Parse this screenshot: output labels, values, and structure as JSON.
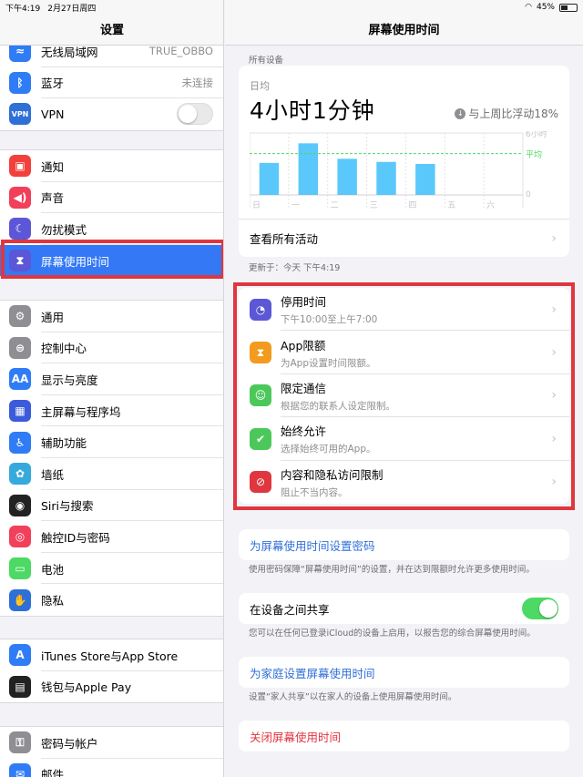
{
  "status": {
    "time": "下午4:19",
    "date": "2月27日周四",
    "battery": "45%",
    "battery_level": 0.45
  },
  "sidebar": {
    "title": "设置",
    "group1": [
      {
        "label": "无线局域网",
        "value": "TRUE_OBBO",
        "icon": "wifi-icon",
        "color": "#2f7cf6",
        "glyph": "≈"
      },
      {
        "label": "蓝牙",
        "value": "未连接",
        "icon": "bluetooth-icon",
        "color": "#2f7cf6",
        "glyph": "ᛒ"
      },
      {
        "label": "VPN",
        "value": "",
        "icon": "vpn-icon",
        "color": "#2f6fd8",
        "glyph": "VPN"
      }
    ],
    "group2": [
      {
        "label": "通知",
        "icon": "notification-icon",
        "color": "#f2403a",
        "glyph": "▣"
      },
      {
        "label": "声音",
        "icon": "sound-icon",
        "color": "#f2405a",
        "glyph": "◀)"
      },
      {
        "label": "勿扰模式",
        "icon": "moon-icon",
        "color": "#5b57d6",
        "glyph": "☾"
      },
      {
        "label": "屏幕使用时间",
        "icon": "hourglass-icon",
        "color": "#5b57d6",
        "glyph": "⧗"
      }
    ],
    "group3": [
      {
        "label": "通用",
        "icon": "gear-icon",
        "color": "#8e8e93",
        "glyph": "⚙"
      },
      {
        "label": "控制中心",
        "icon": "control-center-icon",
        "color": "#8e8e93",
        "glyph": "⊜"
      },
      {
        "label": "显示与亮度",
        "icon": "display-icon",
        "color": "#2f7cf6",
        "glyph": "AA"
      },
      {
        "label": "主屏幕与程序坞",
        "icon": "home-screen-icon",
        "color": "#3b5bdb",
        "glyph": "▦"
      },
      {
        "label": "辅助功能",
        "icon": "accessibility-icon",
        "color": "#2f7cf6",
        "glyph": "♿"
      },
      {
        "label": "墙纸",
        "icon": "wallpaper-icon",
        "color": "#36aadc",
        "glyph": "✿"
      },
      {
        "label": "Siri与搜索",
        "icon": "siri-icon",
        "color": "#222",
        "glyph": "◉"
      },
      {
        "label": "触控ID与密码",
        "icon": "touch-id-icon",
        "color": "#f2405a",
        "glyph": "◎"
      },
      {
        "label": "电池",
        "icon": "battery-icon",
        "color": "#4cd964",
        "glyph": "▭"
      },
      {
        "label": "隐私",
        "icon": "hand-icon",
        "color": "#2f6fd8",
        "glyph": "✋"
      }
    ],
    "group4": [
      {
        "label": "iTunes Store与App Store",
        "icon": "app-store-icon",
        "color": "#2f7cf6",
        "glyph": "A"
      },
      {
        "label": "钱包与Apple Pay",
        "icon": "wallet-icon",
        "color": "#222",
        "glyph": "▤"
      }
    ],
    "group5": [
      {
        "label": "密码与帐户",
        "icon": "key-icon",
        "color": "#8e8e93",
        "glyph": "⚿"
      },
      {
        "label": "邮件",
        "icon": "mail-icon",
        "color": "#2f7cf6",
        "glyph": "✉"
      }
    ]
  },
  "main": {
    "title": "屏幕使用时间",
    "devices_label": "所有设备",
    "daily_avg_label": "日均",
    "daily_avg_value": "4小时1分钟",
    "compare_text": "与上周比浮动18%",
    "view_all": "查看所有活动",
    "updated": "更新于：今天 下午4:19",
    "options": [
      {
        "title": "停用时间",
        "sub": "下午10:00至上午7:00",
        "icon": "downtime-icon",
        "color": "#5b57d6",
        "glyph": "◔"
      },
      {
        "title": "App限额",
        "sub": "为App设置时间限额。",
        "icon": "hourglass-icon",
        "color": "#f29b1e",
        "glyph": "⧗"
      },
      {
        "title": "限定通信",
        "sub": "根据您的联系人设定限制。",
        "icon": "contact-icon",
        "color": "#4cc85a",
        "glyph": "☺"
      },
      {
        "title": "始终允许",
        "sub": "选择始终可用的App。",
        "icon": "checkmark-icon",
        "color": "#4cc85a",
        "glyph": "✔"
      },
      {
        "title": "内容和隐私访问限制",
        "sub": "阻止不当内容。",
        "icon": "restriction-icon",
        "color": "#e0363f",
        "glyph": "⊘"
      }
    ],
    "passcode_link": "为屏幕使用时间设置密码",
    "passcode_note": "使用密码保障“屏幕使用时间”的设置，并在达到限额时允许更多使用时间。",
    "share_label": "在设备之间共享",
    "share_note": "您可以在任何已登录iCloud的设备上启用，以报告您的综合屏幕使用时间。",
    "family_link": "为家庭设置屏幕使用时间",
    "family_note": "设置“家人共享”以在家人的设备上使用屏幕使用时间。",
    "turn_off": "关闭屏幕使用时间"
  },
  "chart_data": {
    "type": "bar",
    "categories": [
      "日",
      "一",
      "二",
      "三",
      "四",
      "五",
      "六"
    ],
    "values": [
      3.1,
      5.0,
      3.5,
      3.2,
      3.0,
      null,
      null
    ],
    "ylim": [
      0,
      6
    ],
    "ytick_labels": [
      "6小时",
      "0"
    ],
    "average_label": "平均",
    "average_value": 4.0,
    "bar_color": "#5ac8fa",
    "average_color": "#4cd964"
  }
}
